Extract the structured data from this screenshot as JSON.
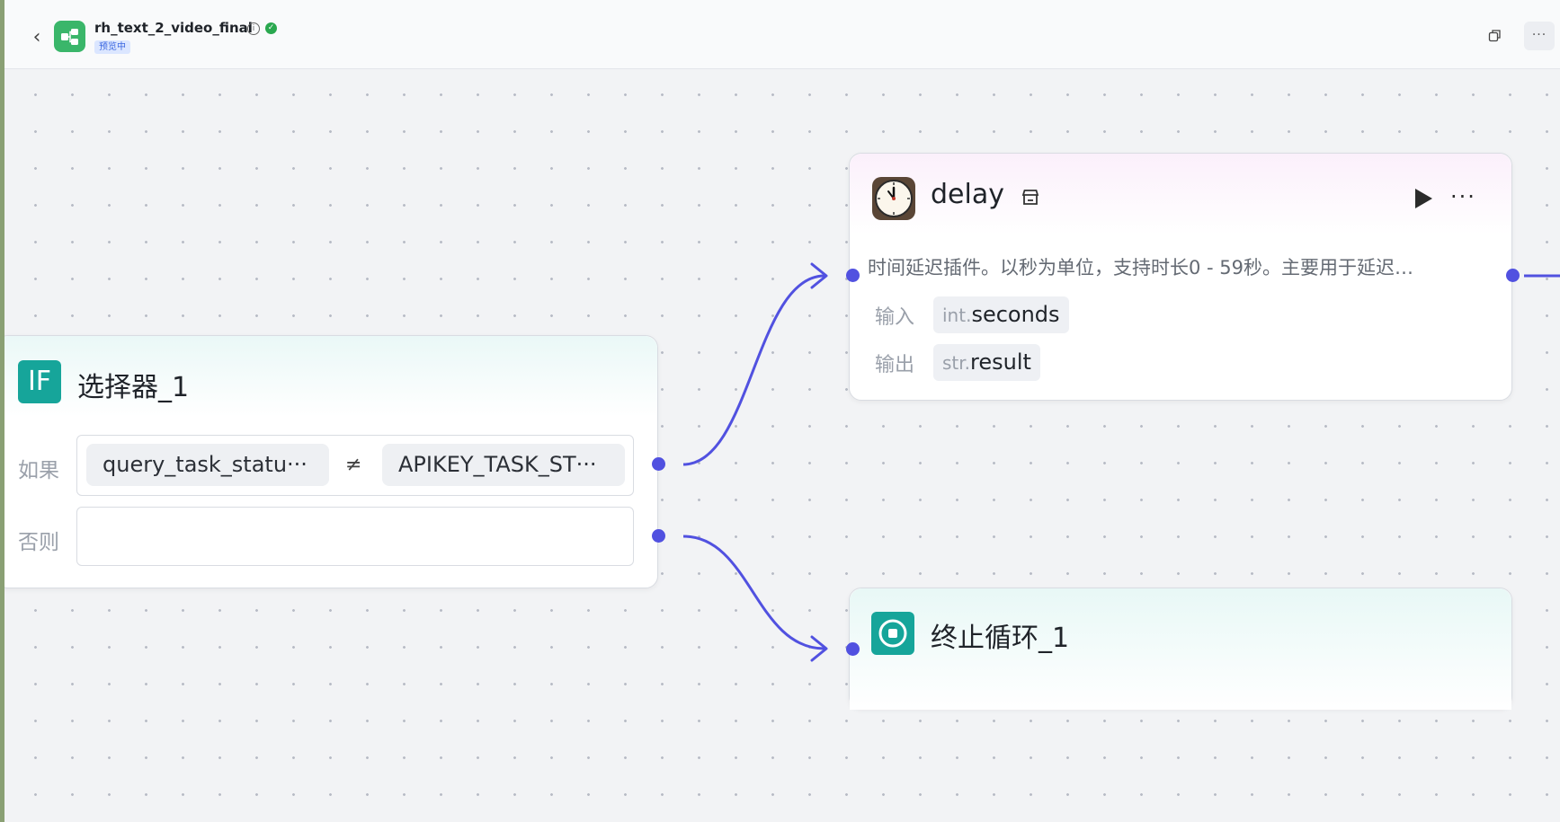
{
  "topbar": {
    "title": "rh_text_2_video_final",
    "badge": "预览中",
    "more_label": "···"
  },
  "nodes": {
    "if": {
      "title": "选择器_1",
      "icon_text": "IF",
      "if_label": "如果",
      "else_label": "否则",
      "left_operand": "query_task_statu···",
      "operator": "≠",
      "right_operand": "APIKEY_TASK_ST···"
    },
    "delay": {
      "title": "delay",
      "description": "时间延迟插件。以秒为单位，支持时长0 - 59秒。主要用于延迟…",
      "input_label": "输入",
      "input_type": "int.",
      "input_name": "seconds",
      "output_label": "输出",
      "output_type": "str.",
      "output_name": "result",
      "more_label": "···"
    },
    "stop": {
      "title": "终止循环_1"
    }
  },
  "colors": {
    "port": "#5151e0",
    "edge": "#5151e0",
    "if_icon": "#16a59a",
    "stop_icon": "#16a59a",
    "app_icon": "#3ab66a"
  },
  "icons": {
    "back": "chevron-left-icon",
    "app": "workflow-icon",
    "info": "info-icon",
    "status": "check-circle-icon",
    "window": "popout-icon",
    "delay": "clock-icon",
    "store": "store-icon",
    "run": "play-icon",
    "stop": "stop-circle-icon"
  }
}
